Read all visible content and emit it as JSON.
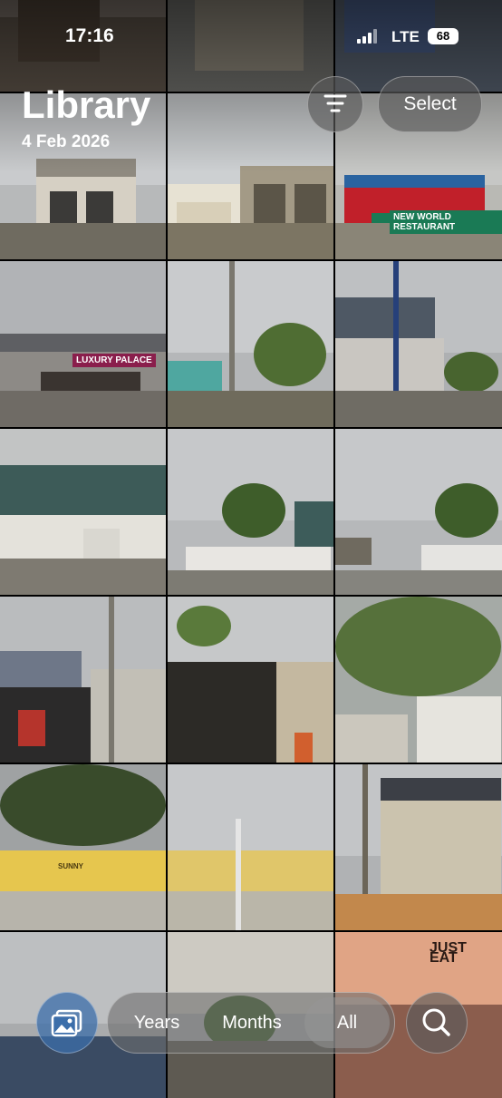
{
  "status_bar": {
    "time": "17:16",
    "network": "LTE",
    "battery": "68"
  },
  "header": {
    "title": "Library",
    "date": "4 Feb 2026",
    "select_label": "Select"
  },
  "grid_signs": {
    "new_world": "NEW WORLD RESTAURANT",
    "luxury_palace": "LUXURY PALACE",
    "just_eat": "JUST EAT",
    "sunny": "SUNNY"
  },
  "bottom_bar": {
    "segments": [
      {
        "label": "Years"
      },
      {
        "label": "Months"
      },
      {
        "label": "All"
      }
    ],
    "active_segment": "All"
  },
  "icons": {
    "filter": "sort-filter-icon",
    "library": "photo-library-icon",
    "search": "search-icon"
  }
}
